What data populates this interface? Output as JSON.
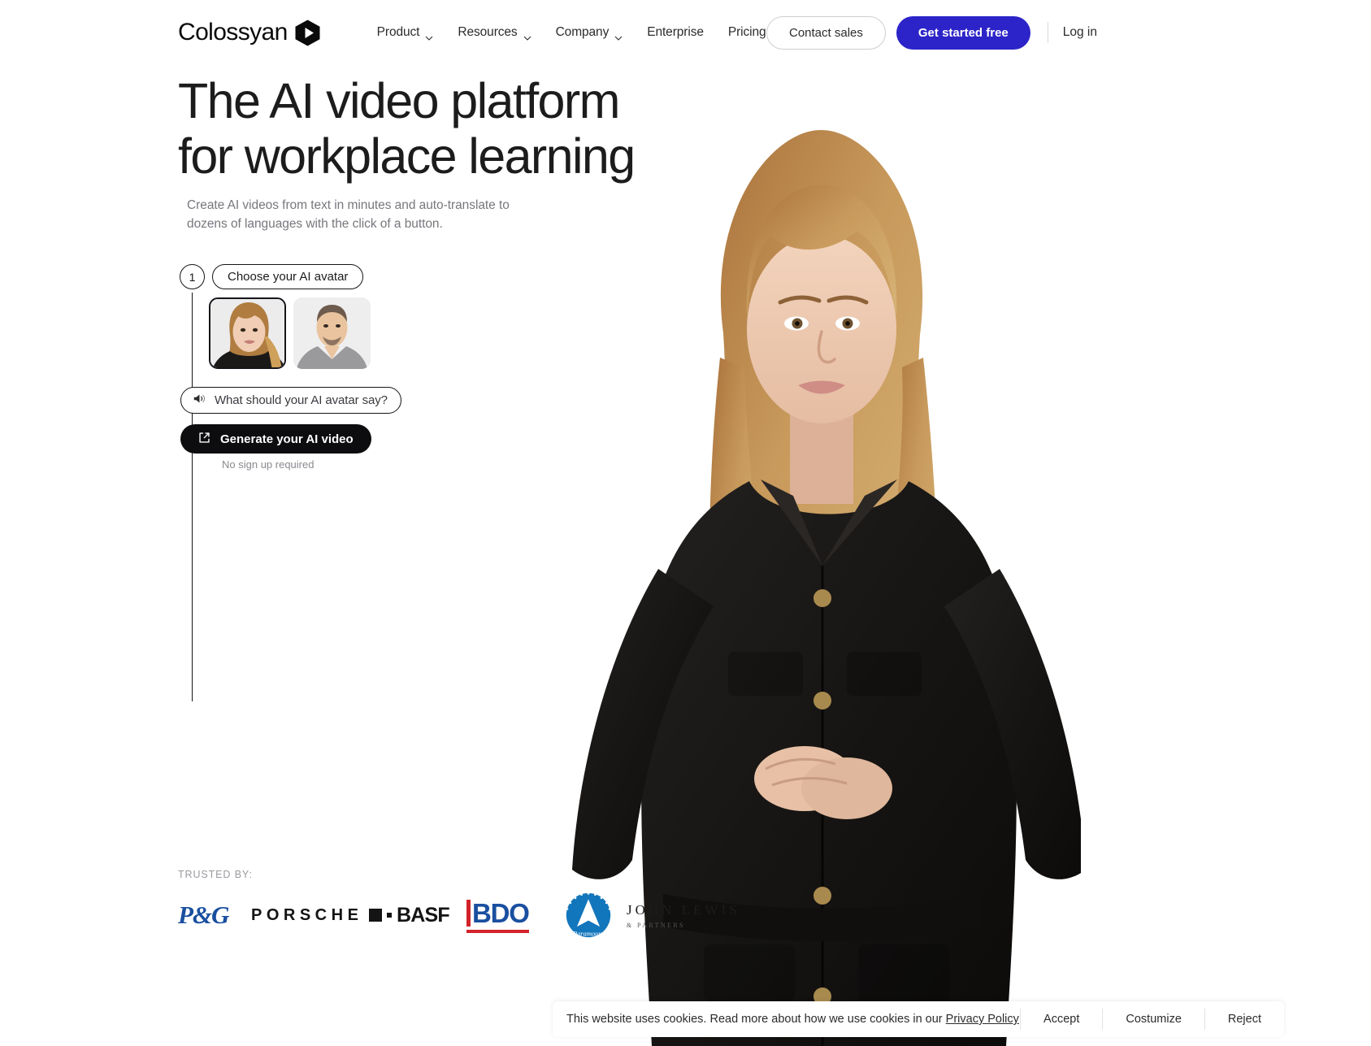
{
  "brand": {
    "name": "Colossyan",
    "mark_icon": "hexagon-play-icon"
  },
  "nav": {
    "links": [
      {
        "label": "Product",
        "has_caret": true
      },
      {
        "label": "Resources",
        "has_caret": true
      },
      {
        "label": "Company",
        "has_caret": true
      },
      {
        "label": "Enterprise",
        "has_caret": false
      },
      {
        "label": "Pricing",
        "has_caret": false
      }
    ],
    "contact_sales": "Contact sales",
    "get_started": "Get started free",
    "log_in": "Log in",
    "accent_color": "#2c24c8"
  },
  "hero": {
    "headline_line1": "The AI video platform",
    "headline_line2": "for workplace learning",
    "sub_line1": "Create AI videos from text in minutes and auto-translate",
    "sub_line2": "to dozens of languages with the click of a button."
  },
  "widget": {
    "step_number": "1",
    "step_label": "Choose your AI avatar",
    "avatars": [
      {
        "name": "avatar-female",
        "selected": true
      },
      {
        "name": "avatar-male",
        "selected": false
      }
    ],
    "say_placeholder": "What should your AI avatar say?",
    "say_icon": "speaker-icon",
    "generate_label": "Generate your AI video",
    "generate_icon": "external-link-icon",
    "no_signup": "No sign up required"
  },
  "trusted": {
    "label": "TRUSTED BY:",
    "logos": [
      {
        "name": "pg",
        "text": "P&G",
        "color": "#1a4fa0"
      },
      {
        "name": "porsche",
        "text": "PORSCHE",
        "color": "#141414"
      },
      {
        "name": "basf",
        "text": "BASF",
        "color": "#141414"
      },
      {
        "name": "bdo",
        "text": "BDO",
        "color": "#1a4fa0"
      },
      {
        "name": "paramount",
        "text": "Paramount",
        "color": "#1276bc"
      },
      {
        "name": "john-lewis",
        "text": "JOHN LEWIS",
        "sub": "& PARTNERS",
        "color": "#1c1c1c"
      }
    ]
  },
  "cookie": {
    "message_before_link": "This website uses cookies. Read more about how we use cookies in our ",
    "link_text": "Privacy Policy",
    "accept": "Accept",
    "customize": "Costumize",
    "reject": "Reject"
  }
}
